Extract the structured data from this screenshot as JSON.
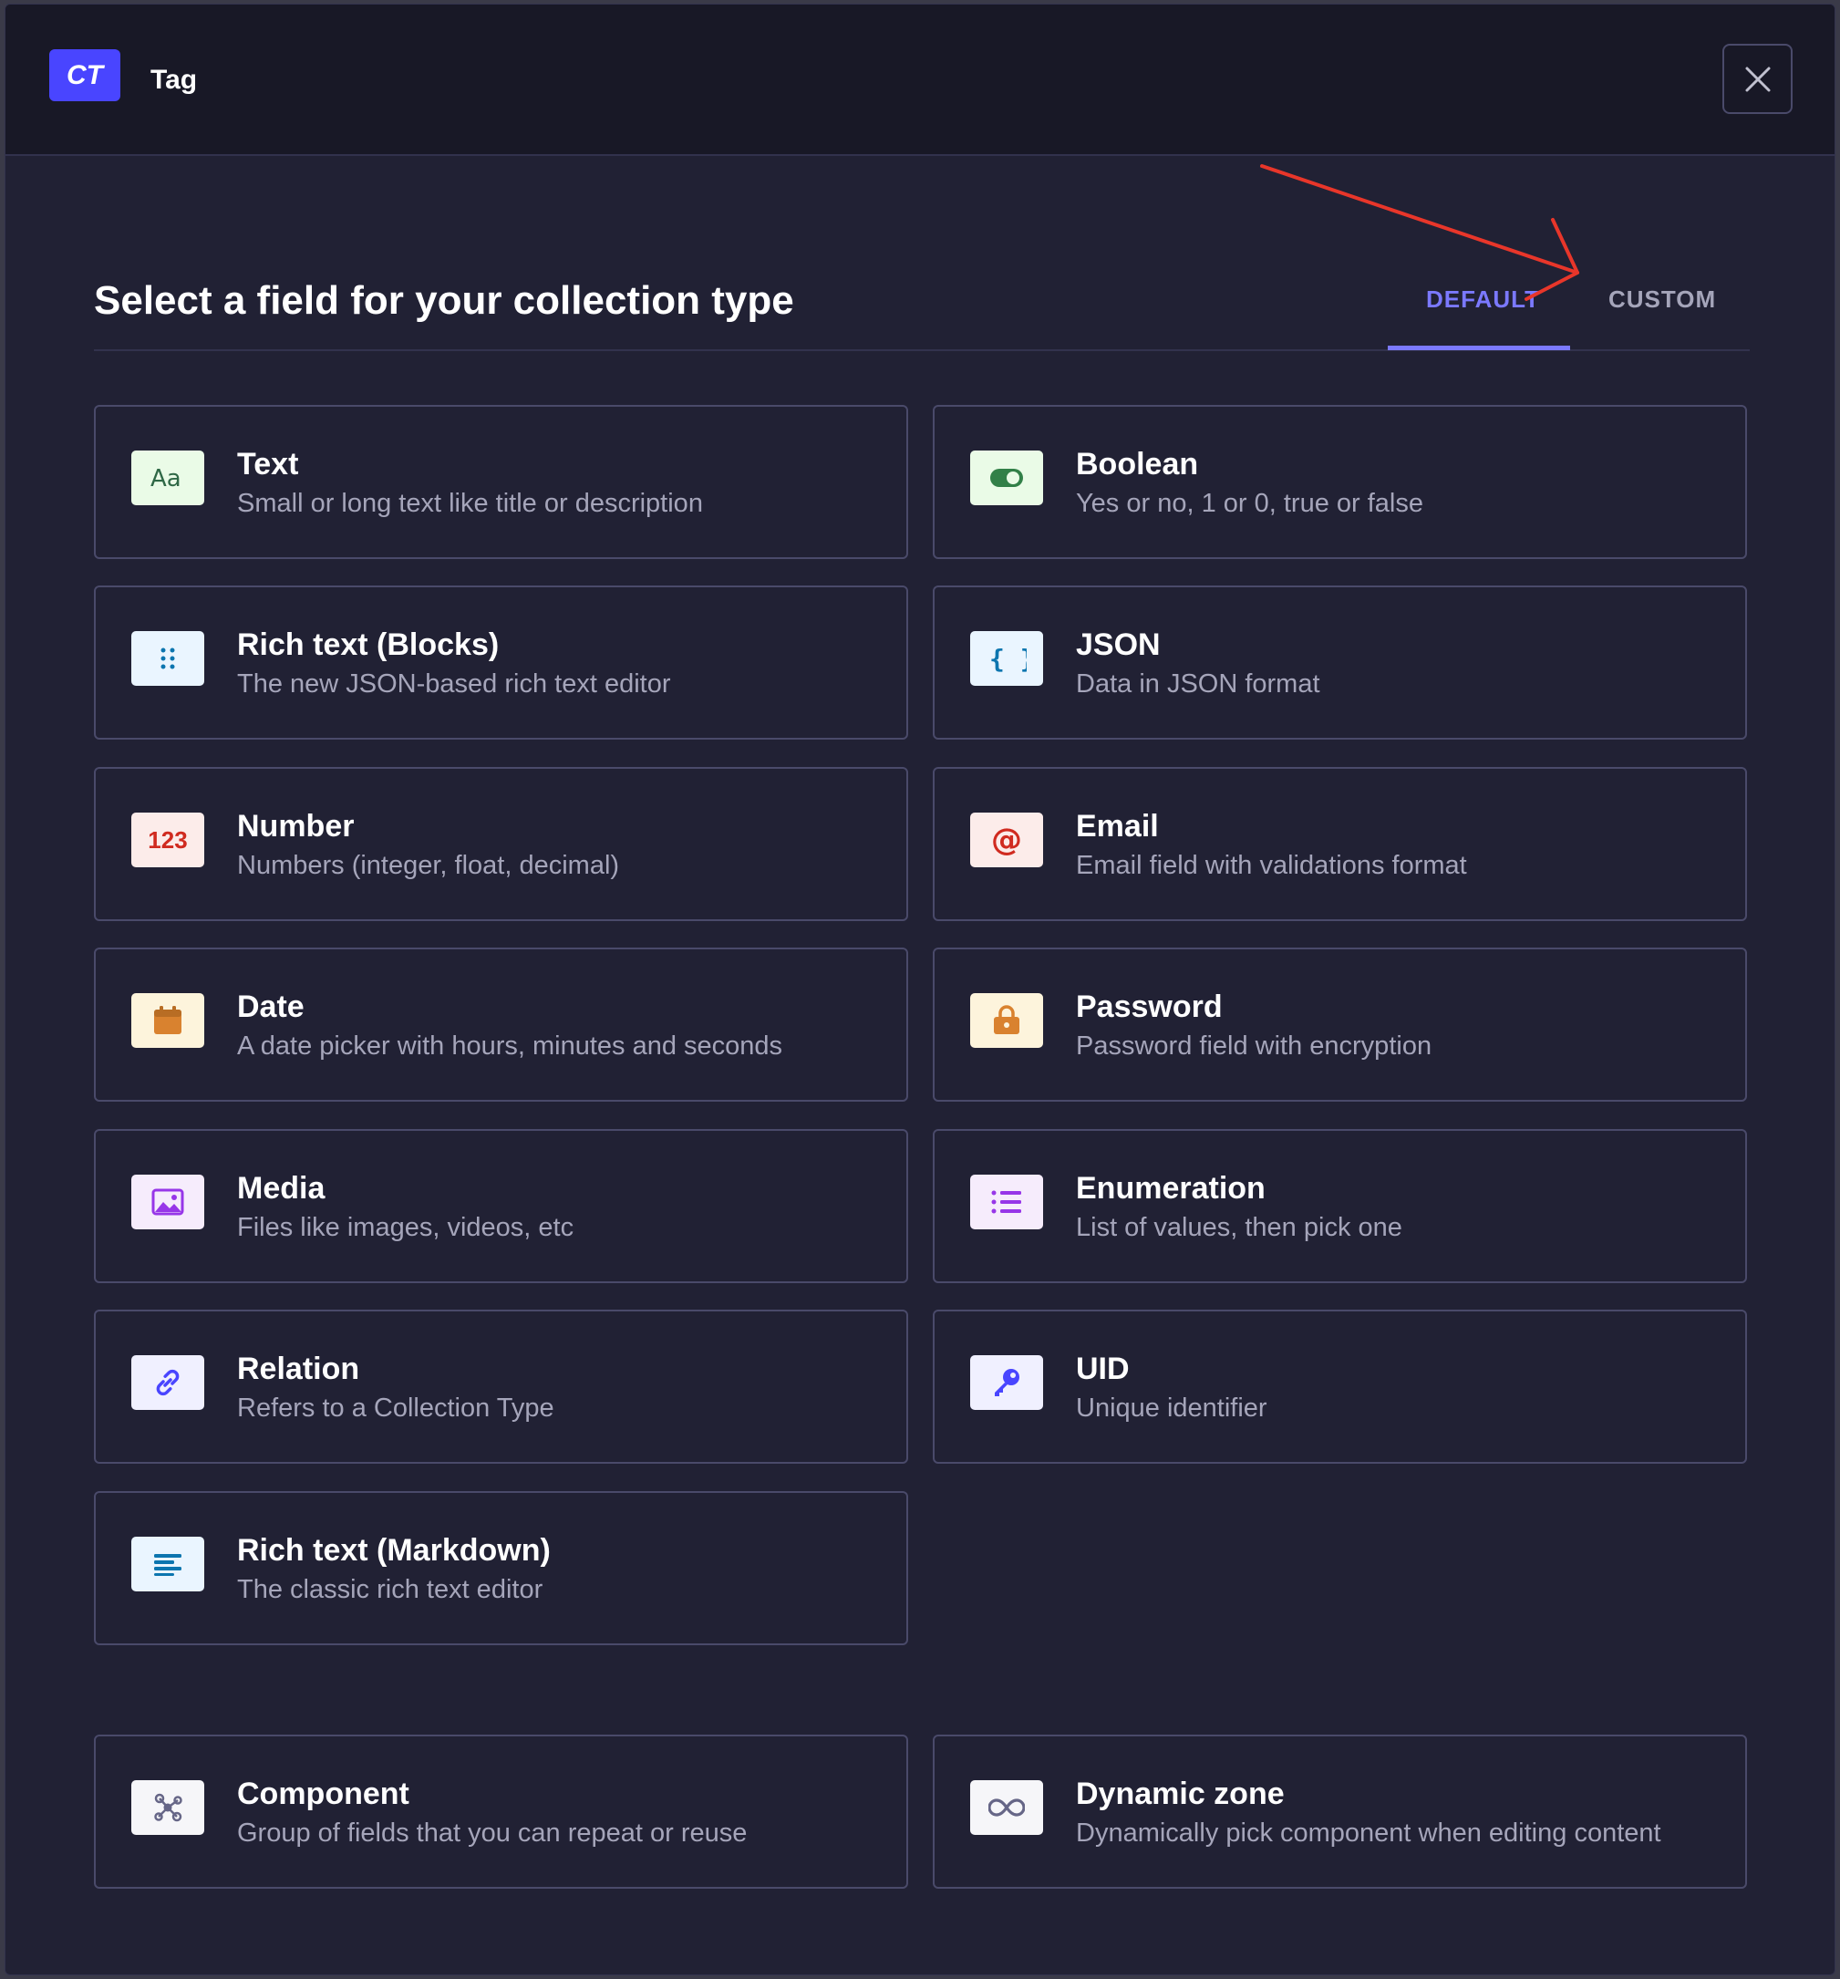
{
  "header": {
    "badge": "CT",
    "title": "Tag"
  },
  "main": {
    "heading": "Select a field for your collection type",
    "tabs": [
      {
        "label": "DEFAULT",
        "selected": true
      },
      {
        "label": "CUSTOM",
        "selected": false
      }
    ],
    "fields": [
      {
        "title": "Text",
        "description": "Small or long text like title or description",
        "icon": "text-icon"
      },
      {
        "title": "Boolean",
        "description": "Yes or no, 1 or 0, true or false",
        "icon": "toggle-icon"
      },
      {
        "title": "Rich text (Blocks)",
        "description": "The new JSON-based rich text editor",
        "icon": "drag-dots-icon"
      },
      {
        "title": "JSON",
        "description": "Data in JSON format",
        "icon": "braces-icon"
      },
      {
        "title": "Number",
        "description": "Numbers (integer, float, decimal)",
        "icon": "number-icon",
        "icon_text": "123"
      },
      {
        "title": "Email",
        "description": "Email field with validations format",
        "icon": "at-sign-icon",
        "icon_text": "@"
      },
      {
        "title": "Date",
        "description": "A date picker with hours, minutes and seconds",
        "icon": "calendar-icon"
      },
      {
        "title": "Password",
        "description": "Password field with encryption",
        "icon": "lock-icon"
      },
      {
        "title": "Media",
        "description": "Files like images, videos, etc",
        "icon": "image-icon"
      },
      {
        "title": "Enumeration",
        "description": "List of values, then pick one",
        "icon": "list-icon"
      },
      {
        "title": "Relation",
        "description": "Refers to a Collection Type",
        "icon": "link-icon"
      },
      {
        "title": "UID",
        "description": "Unique identifier",
        "icon": "key-icon"
      },
      {
        "title": "Rich text (Markdown)",
        "description": "The classic rich text editor",
        "icon": "paragraph-icon"
      },
      {
        "title": "Component",
        "description": "Group of fields that you can repeat or reuse",
        "icon": "component-icon"
      },
      {
        "title": "Dynamic zone",
        "description": "Dynamically pick component when editing content",
        "icon": "infinity-icon"
      }
    ]
  },
  "colors": {
    "accent": "#7b79ff",
    "brand": "#4945ff",
    "annotation_arrow": "#e8362a"
  }
}
